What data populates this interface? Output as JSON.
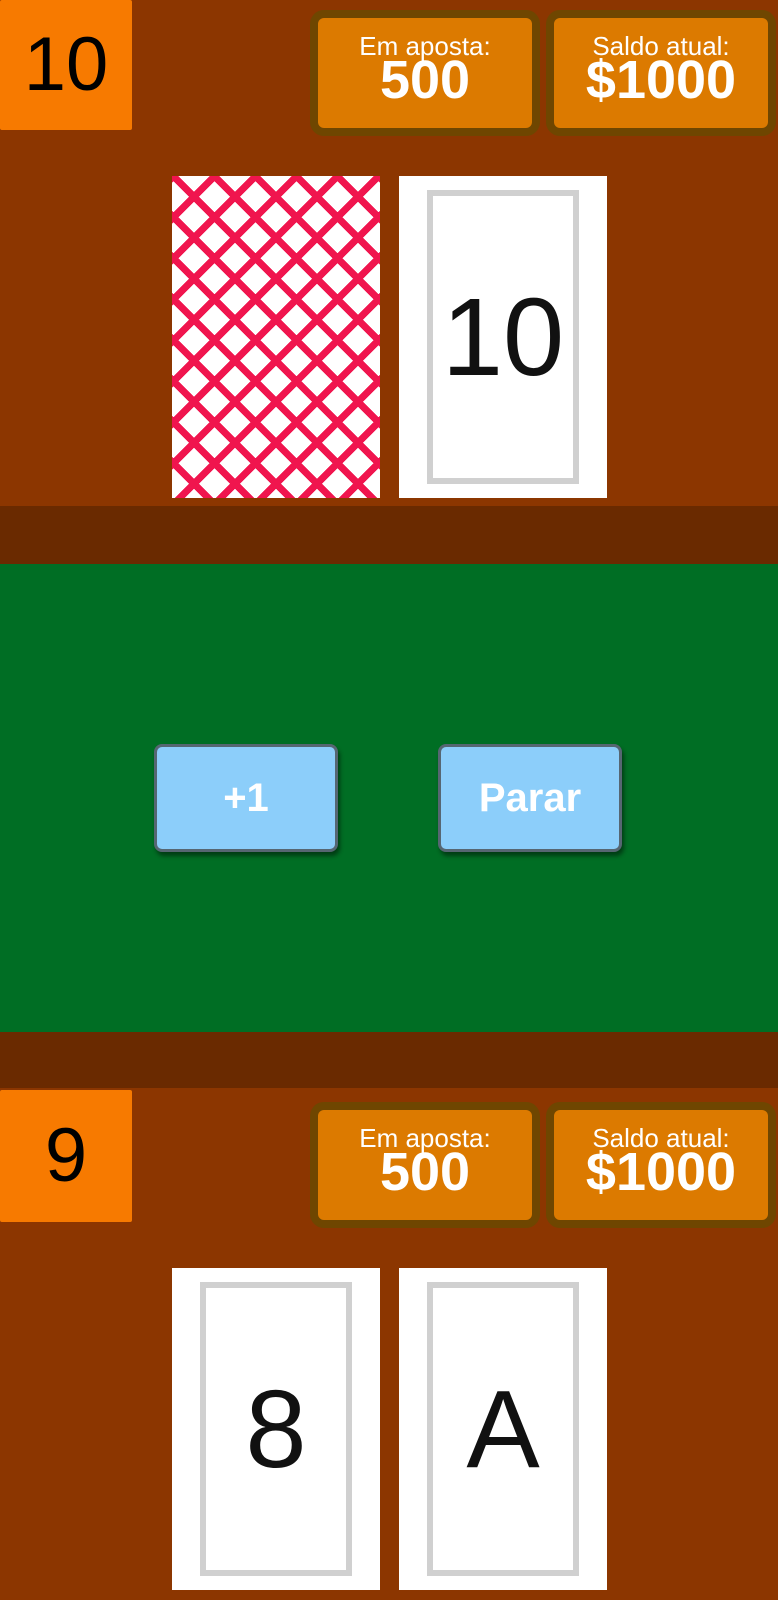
{
  "dealer": {
    "score": "10",
    "bet_label": "Em aposta:",
    "bet_value": "500",
    "balance_label": "Saldo atual:",
    "balance_value": "$1000",
    "cards": [
      {
        "face": "back",
        "rank": ""
      },
      {
        "face": "up",
        "rank": "10"
      }
    ]
  },
  "actions": {
    "hit_label": "+1",
    "stand_label": "Parar"
  },
  "player": {
    "score": "9",
    "bet_label": "Em aposta:",
    "bet_value": "500",
    "balance_label": "Saldo atual:",
    "balance_value": "$1000",
    "cards": [
      {
        "face": "up",
        "rank": "8"
      },
      {
        "face": "up",
        "rank": "A"
      }
    ]
  },
  "colors": {
    "table_wood": "#8c3600",
    "divider": "#6a2a00",
    "felt": "#006e24",
    "score_box": "#f77a00",
    "info_box": "#dc7a00",
    "button": "#8ccefa",
    "card_back_pattern": "#f0154e"
  }
}
